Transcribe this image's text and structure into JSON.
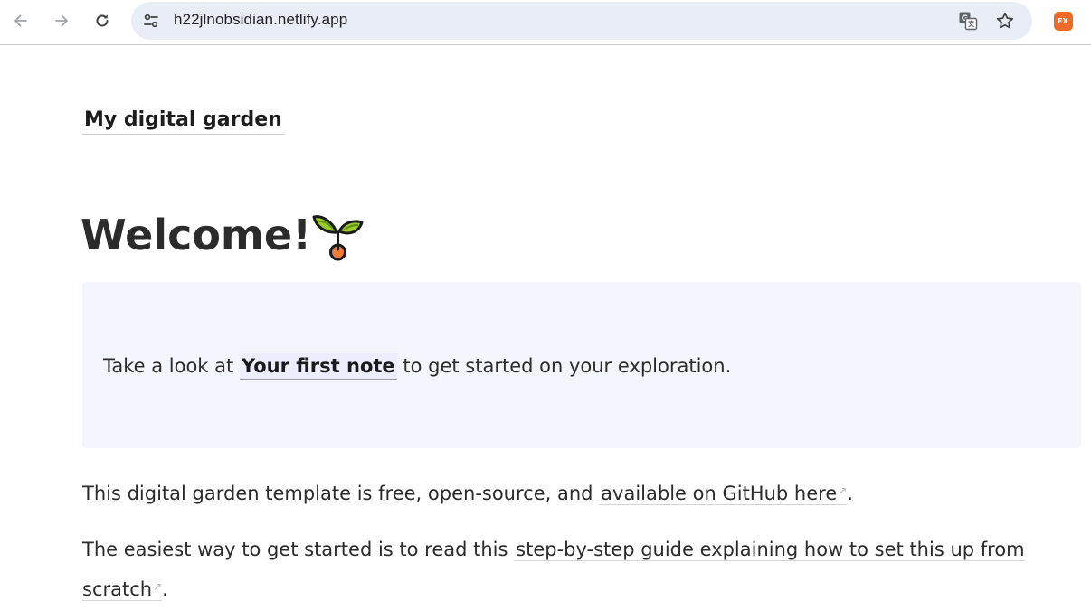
{
  "browser": {
    "url": "h22jlnobsidian.netlify.app",
    "extension_badge": "EX",
    "accent_color": "#f06a2a",
    "icons": {
      "back": "back-arrow-icon",
      "forward": "forward-arrow-icon",
      "reload": "reload-icon",
      "site_info": "site-info-tune-icon",
      "translate": "translate-icon",
      "bookmark": "star-icon"
    }
  },
  "page": {
    "site_title": "My digital garden",
    "heading": "Welcome!",
    "heading_icon": "seedling-icon",
    "callout": {
      "text_before": "Take a look at ",
      "link_text": "Your first note",
      "text_after": " to get started on your exploration.",
      "background": "#f3f5fd"
    },
    "paragraph1": {
      "text_before": "This digital garden template is free, open-source, and ",
      "link_text": "available on GitHub here",
      "text_after": "."
    },
    "paragraph2": {
      "text_before": "The easiest way to get started is to read this ",
      "link_text": "step-by-step guide explaining how to set this up from scratch",
      "text_after": "."
    },
    "external_link_mark": "↗"
  }
}
